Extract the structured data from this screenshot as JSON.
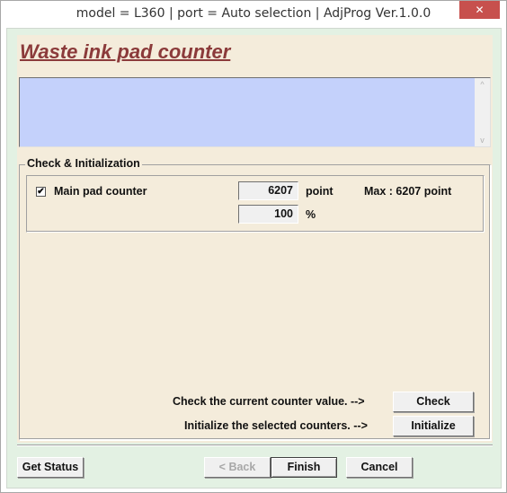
{
  "window": {
    "title": "model = L360 | port = Auto selection | AdjProg Ver.1.0.0",
    "close_glyph": "✕"
  },
  "page": {
    "heading": "Waste ink pad counter",
    "log_text": ""
  },
  "group": {
    "label": "Check & Initialization",
    "counters": [
      {
        "label": "Main pad counter",
        "checked": true,
        "check_glyph": "✔",
        "value": "6207",
        "value_unit": "point",
        "percent": "100",
        "percent_unit": "%",
        "max_text": "Max : 6207 point"
      }
    ],
    "check_hint": "Check the current counter value. -->",
    "check_button": "Check",
    "init_hint": "Initialize the selected counters. -->",
    "init_button": "Initialize"
  },
  "footer": {
    "get_status": "Get Status",
    "back": "< Back",
    "finish": "Finish",
    "cancel": "Cancel"
  },
  "icons": {
    "scroll_up": "^",
    "scroll_down": "v"
  }
}
